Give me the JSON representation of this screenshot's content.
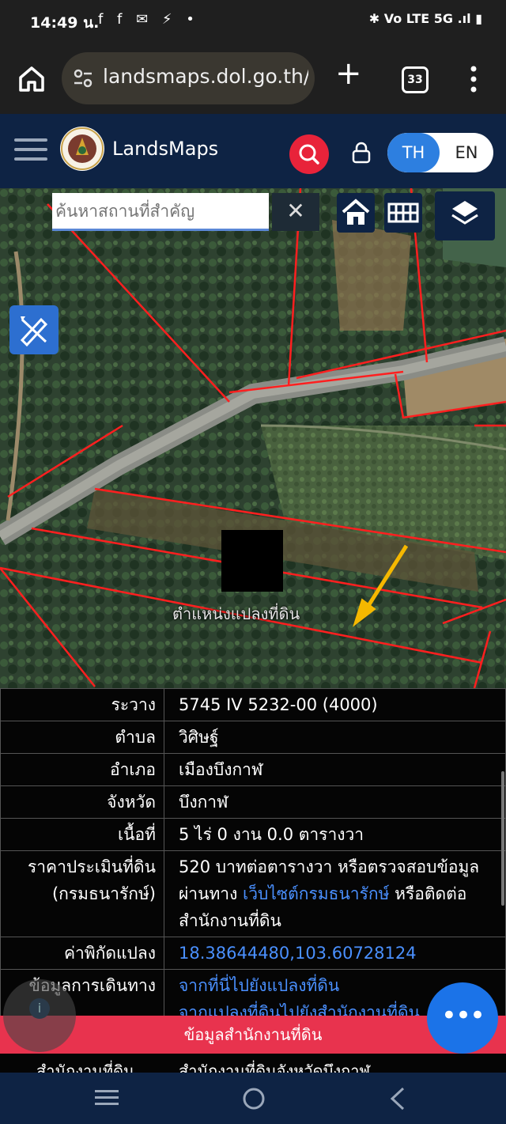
{
  "status_bar": {
    "time": "14:49 น.",
    "notification_icons": "f f ✉ ⚡ •",
    "right": "✱ Vo LTE 5G .ıl ▮"
  },
  "browser": {
    "url": "landsmaps.dol.go.th/#",
    "tab_count": "33"
  },
  "app": {
    "brand": "LandsMaps",
    "lang_th": "TH",
    "lang_en": "EN"
  },
  "map": {
    "search_placeholder": "ค้นหาสถานที่สำคัญ",
    "clear_symbol": "✕",
    "parcel_label": "ตำแหน่งแปลงที่ดิน"
  },
  "info_rows": [
    {
      "label": "ระวาง",
      "value": "5745 IV 5232-00 (4000)"
    },
    {
      "label": "ตำบล",
      "value": "วิศิษฐ์"
    },
    {
      "label": "อำเภอ",
      "value": "เมืองบึงกาฬ"
    },
    {
      "label": "จังหวัด",
      "value": "บึงกาฬ"
    },
    {
      "label": "เนื้อที่",
      "value": "5 ไร่ 0 งาน 0.0 ตารางวา"
    }
  ],
  "price_row": {
    "label_1": "ราคาประเมินที่ดิน",
    "label_2": "(กรมธนารักษ์)",
    "text_1": "520 บาทต่อตารางวา หรือตรวจสอบข้อมูลผ่านทาง ",
    "link": "เว็บไซต์กรมธนารักษ์",
    "text_2": " หรือติดต่อสำนักงานที่ดิน"
  },
  "coord_row": {
    "label": "ค่าพิกัดแปลง",
    "value": "18.38644480,103.60728124"
  },
  "travel_row": {
    "label": "ข้อมูลการเดินทาง",
    "link_1": "จากที่นี่ไปยังแปลงที่ดิน",
    "link_2": "จากแปลงที่ดินไปยังสำนักงานที่ดิน"
  },
  "office_bar": "ข้อมูลสำนักงานที่ดิน",
  "office_row": {
    "label": "สำนักงานที่ดิน",
    "value": "สำนักงานที่ดินจังหวัดบึงกาฬ"
  },
  "info_button": "i",
  "fab_label": "•••",
  "colors": {
    "header": "#0e2344",
    "accent_red": "#e8233a",
    "accent_blue": "#2d7fe0",
    "parcel_line": "#ff1f1f"
  }
}
